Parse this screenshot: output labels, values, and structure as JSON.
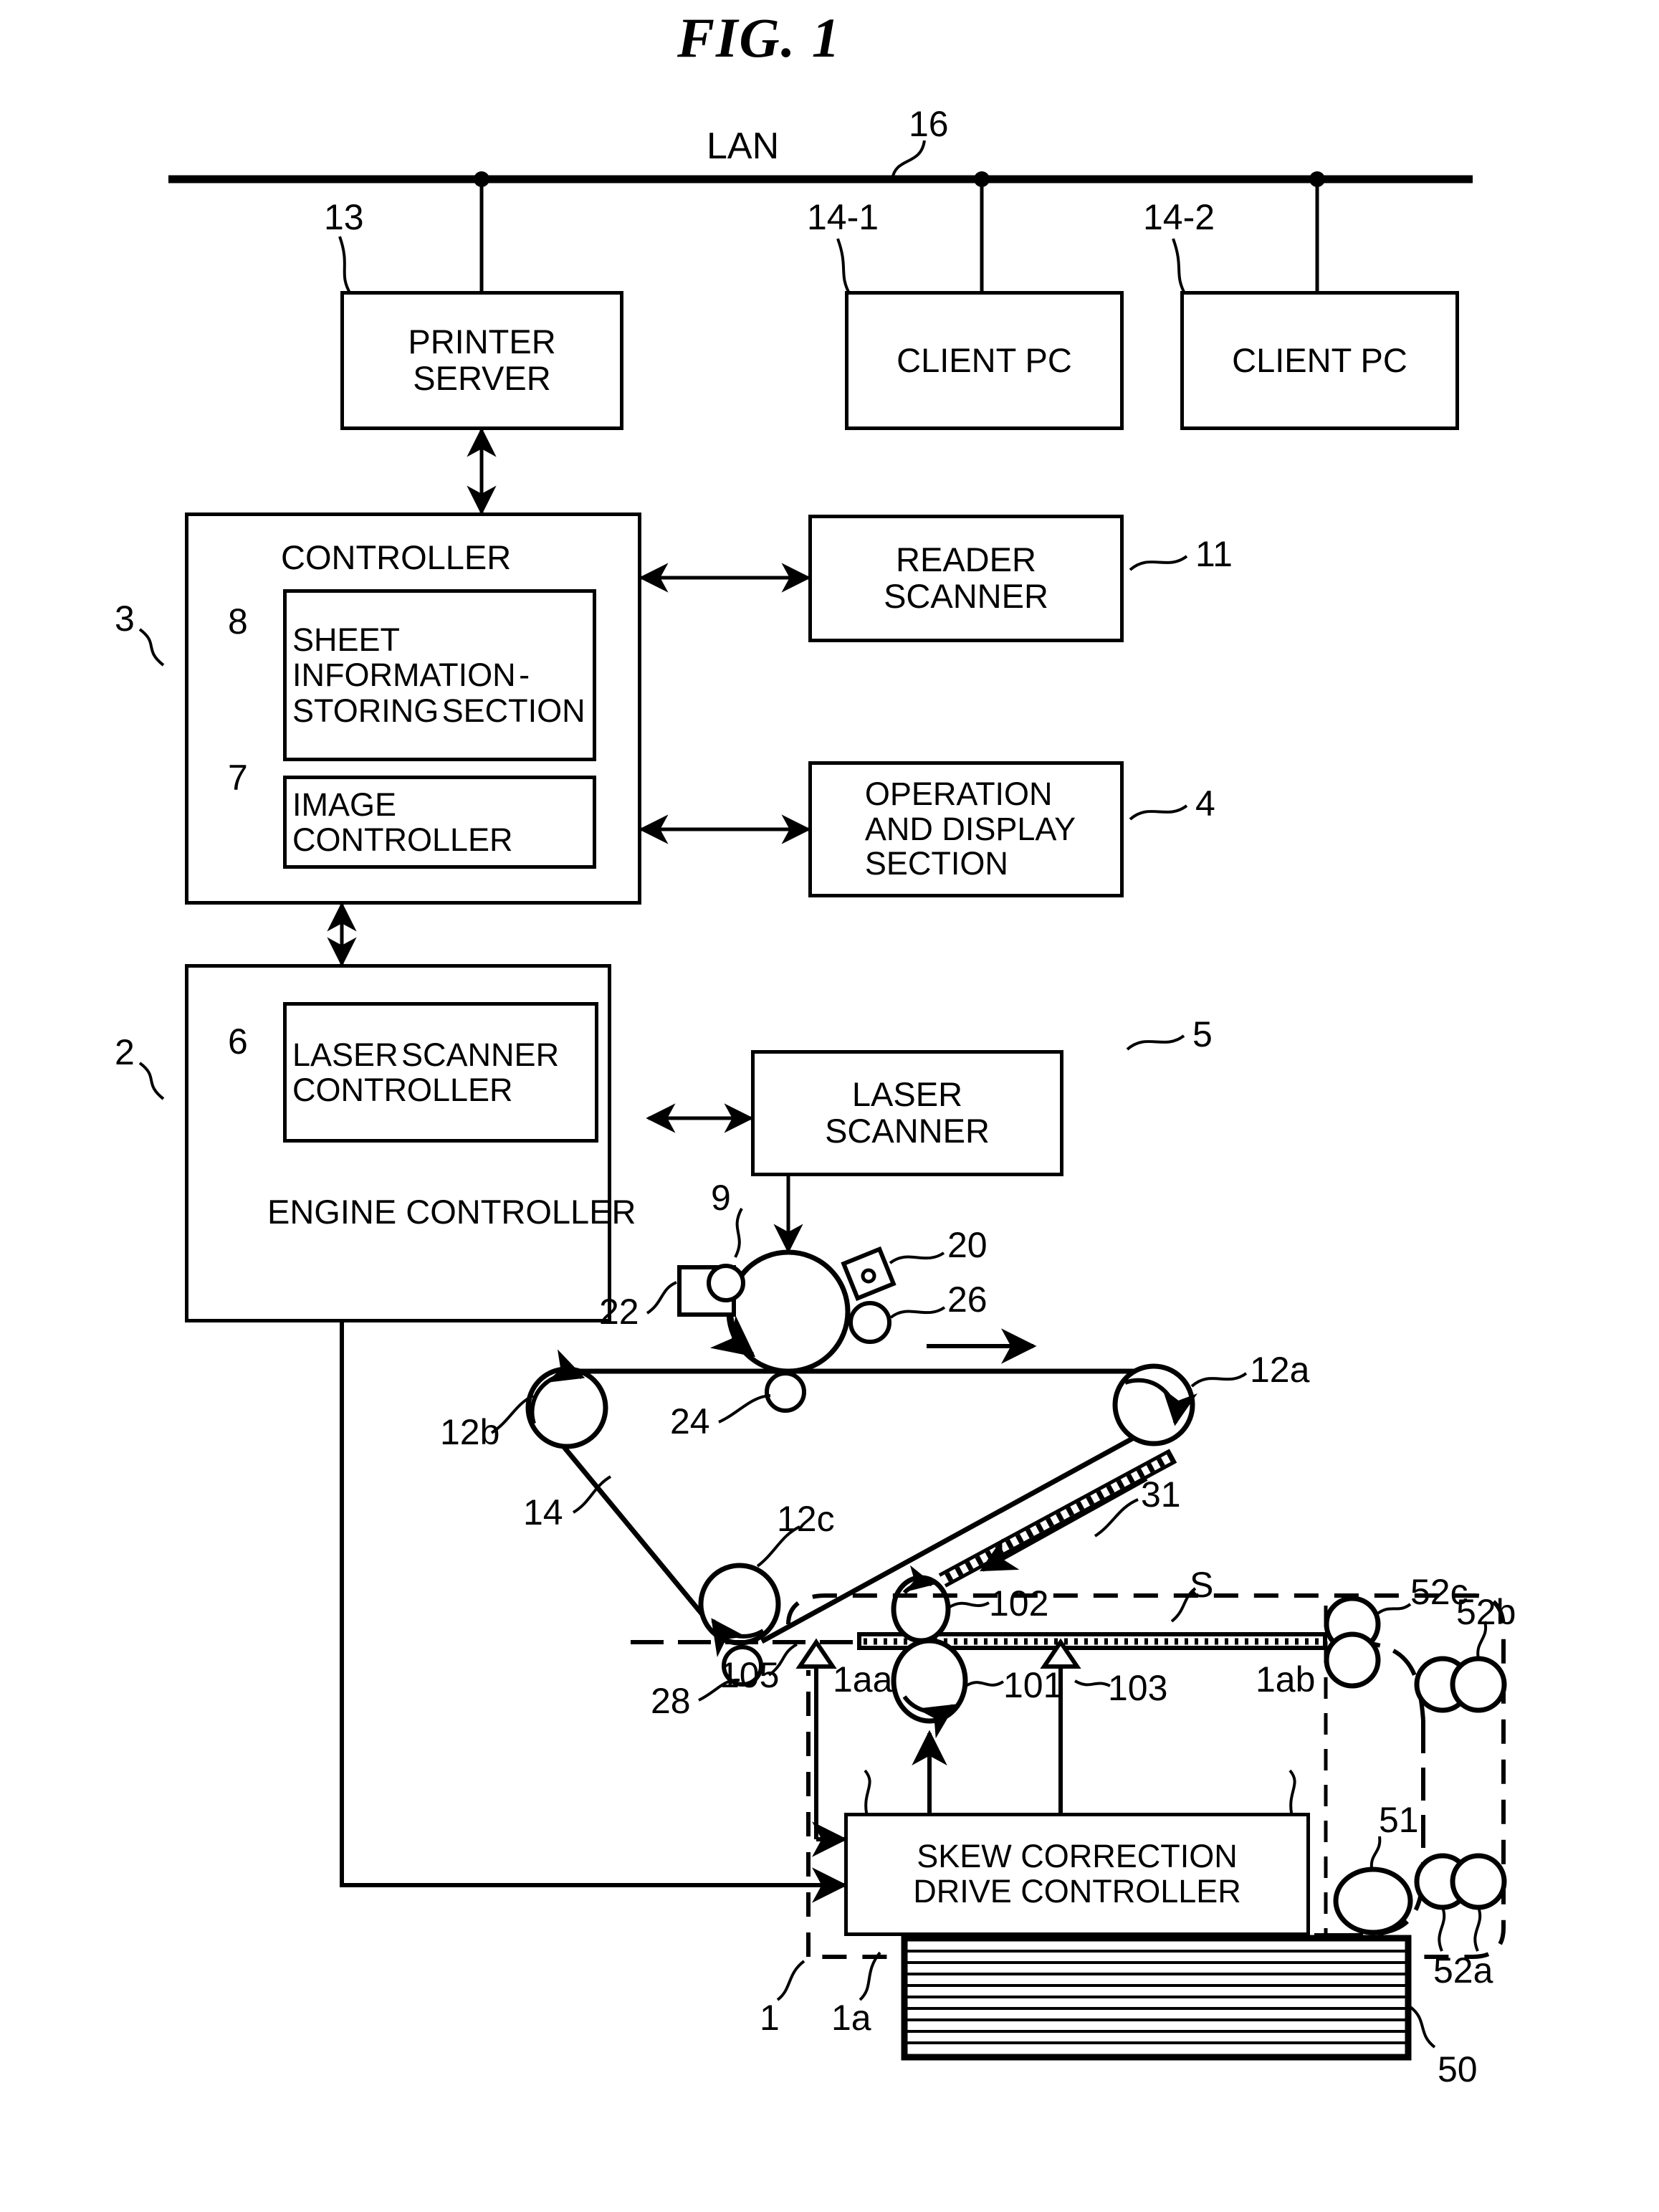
{
  "figure": {
    "title": "FIG. 1",
    "network_label": "LAN"
  },
  "boxes": {
    "printer_server": {
      "line1": "PRINTER",
      "line2": "SERVER",
      "ref": "13"
    },
    "client_pc_1": {
      "label": "CLIENT PC",
      "ref": "14-1"
    },
    "client_pc_2": {
      "label": "CLIENT PC",
      "ref": "14-2"
    },
    "controller": {
      "label": "CONTROLLER",
      "ref": "3"
    },
    "sheet_info": {
      "line1": "SHEET",
      "line2": "INFORMATION",
      "line3": "-STORING",
      "line4": "SECTION",
      "ref": "8"
    },
    "image_controller": {
      "line1": "IMAGE",
      "line2": "CONTROLLER",
      "ref": "7"
    },
    "reader_scanner": {
      "line1": "READER",
      "line2": "SCANNER",
      "ref": "11"
    },
    "operation_display": {
      "line1": "OPERATION",
      "line2": "AND DISPLAY",
      "line3": "SECTION",
      "ref": "4"
    },
    "engine_controller": {
      "line1": "ENGINE",
      "line2": "CONTROLLER",
      "ref": "2"
    },
    "laser_scanner_controller": {
      "line1": "LASER",
      "line2": "SCANNER",
      "line3": "CONTROLLER",
      "ref": "6"
    },
    "laser_scanner": {
      "line1": "LASER",
      "line2": "SCANNER",
      "ref": "5"
    },
    "skew_correction": {
      "line1": "SKEW CORRECTION",
      "line2": "DRIVE CONTROLLER"
    }
  },
  "reference_numerals": {
    "lan": "16",
    "photosensitive_drum": "9",
    "developing_device": "20",
    "charging_roller": "26",
    "cleaner": "22",
    "transfer_roller": "24",
    "belt_roller_a": "12a",
    "belt_roller_b": "12b",
    "belt_roller_c": "12c",
    "transfer_belt": "14",
    "fixing_guide": "31",
    "registration_roller": "28",
    "sheet_sensor": "105",
    "skew_sensor_left": "1aa",
    "skew_sensor_right": "1ab",
    "drive_roller": "101",
    "pressing_roller": "102",
    "shift_actuator": "103",
    "sheet": "S",
    "skew_unit": "1",
    "skew_unit_inner": "1a",
    "pickup_roller": "51",
    "feed_roller_pair_a": "52a",
    "feed_roller_pair_b": "52b",
    "feed_roller_pair_c": "52c",
    "sheet_stack": "50"
  }
}
